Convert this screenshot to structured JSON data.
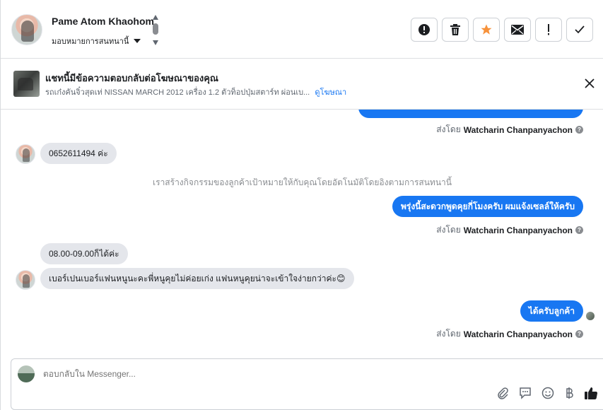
{
  "header": {
    "contact_name": "Pame Atom Khaohom",
    "assign_label": "มอบหมายการสนทนานี้",
    "actions": [
      {
        "icon": "alert-circle-icon"
      },
      {
        "icon": "trash-icon"
      },
      {
        "icon": "star-icon"
      },
      {
        "icon": "envelope-icon"
      },
      {
        "icon": "exclamation-icon"
      },
      {
        "icon": "check-icon"
      }
    ]
  },
  "ad_banner": {
    "title": "แชทนี้มีข้อความตอบกลับต่อโฆษณาของคุณ",
    "subtitle": "รถเก๋งคันจิ๋วสุดเท่ NISSAN MARCH 2012 เครื่อง 1.2 ตัวท็อปปุ่มสตาร์ท ผ่อนเบ...",
    "link_label": "ดูโฆษณา"
  },
  "messages": {
    "sent_by_prefix": "ส่งโดย",
    "agent_name": "Watcharin Chanpanyachon",
    "customer_phone": "0652611494 ค่ะ",
    "system_note": "เราสร้างกิจกรรมของลูกค้าเป้าหมายให้กับคุณโดยอัตโนมัติโดยอิงตามการสนทนานี้",
    "agent_reply_1": "พรุ่งนี้สะดวกพูดคุยกี่โมงครับ ผมแจ้งเซลล์ให้ครับ",
    "customer_time": "08.00-09.00ก็ได้ค่ะ",
    "customer_note": "เบอร์เปนเบอร์แฟนหนูนะคะพี่หนูคุยไม่ค่อยเก่ง แฟนหนูคุยน่าจะเข้าใจง่ายกว่าค่ะ😊",
    "agent_reply_2": "ได้ครับลูกค้า"
  },
  "composer": {
    "placeholder": "ตอบกลับใน Messenger..."
  },
  "colors": {
    "accent": "#1877f2",
    "star": "#f7923b",
    "incoming_bubble": "#e4e6eb"
  }
}
